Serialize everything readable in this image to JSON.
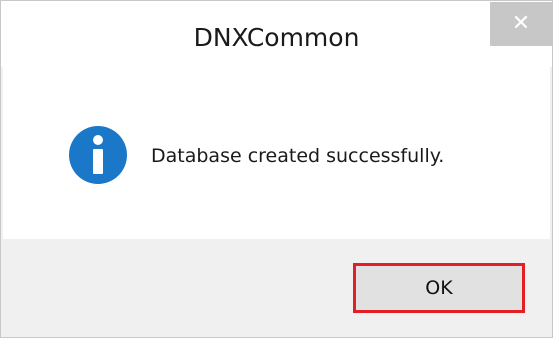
{
  "dialog": {
    "title": "DNXCommon",
    "close_glyph": "✕",
    "message": "Database created successfully.",
    "icon": "info-icon",
    "ok_label": "OK"
  },
  "colors": {
    "icon_blue": "#1b78c8",
    "highlight_border": "#e31f26",
    "close_button_bg": "#c7c7c7"
  }
}
